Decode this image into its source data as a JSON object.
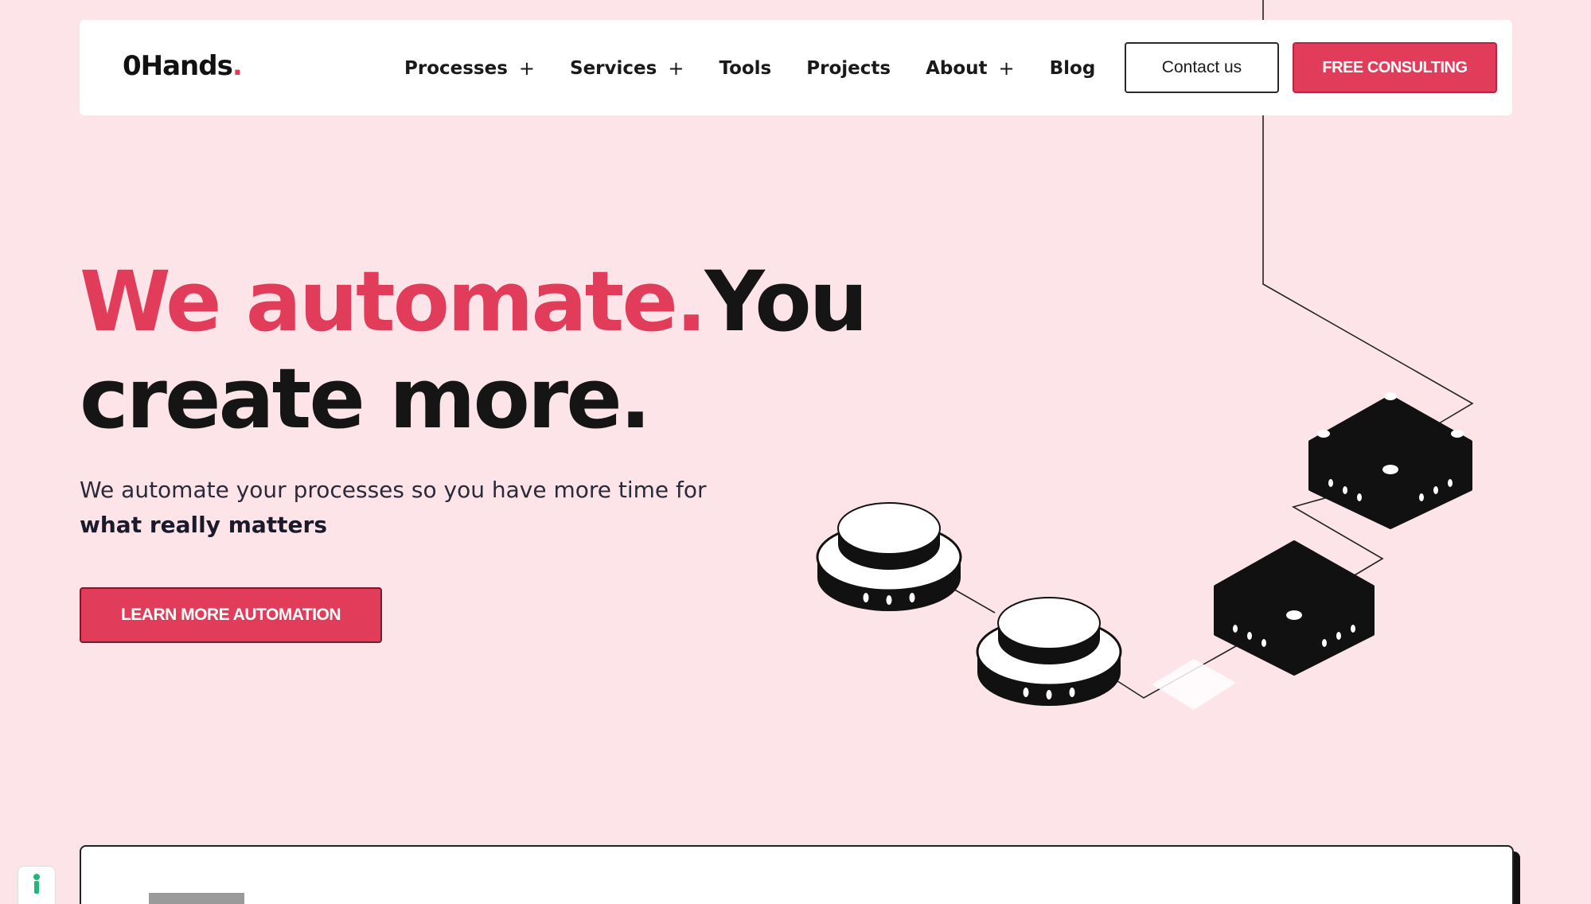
{
  "header": {
    "logo_main": "0Hands",
    "logo_dot": ".",
    "nav": [
      {
        "label": "Processes",
        "has_sub": "+"
      },
      {
        "label": "Services",
        "has_sub": "+"
      },
      {
        "label": "Tools",
        "has_sub": ""
      },
      {
        "label": "Projects",
        "has_sub": ""
      },
      {
        "label": "About",
        "has_sub": "+"
      },
      {
        "label": "Blog",
        "has_sub": ""
      }
    ],
    "contact_label": "Contact us",
    "consult_label": "FREE CONSULTING"
  },
  "hero": {
    "title_accent": "We automate.",
    "title_rest_1": "You",
    "title_rest_2": "create more.",
    "subtitle": "We automate your processes so you have more time for",
    "subtitle_strong": "what really matters",
    "cta_label": "LEARN MORE AUTOMATION"
  },
  "colors": {
    "background": "#fde4e8",
    "accent": "#e13d5a",
    "text": "#151515"
  },
  "icons": {
    "badge": "person-icon"
  }
}
